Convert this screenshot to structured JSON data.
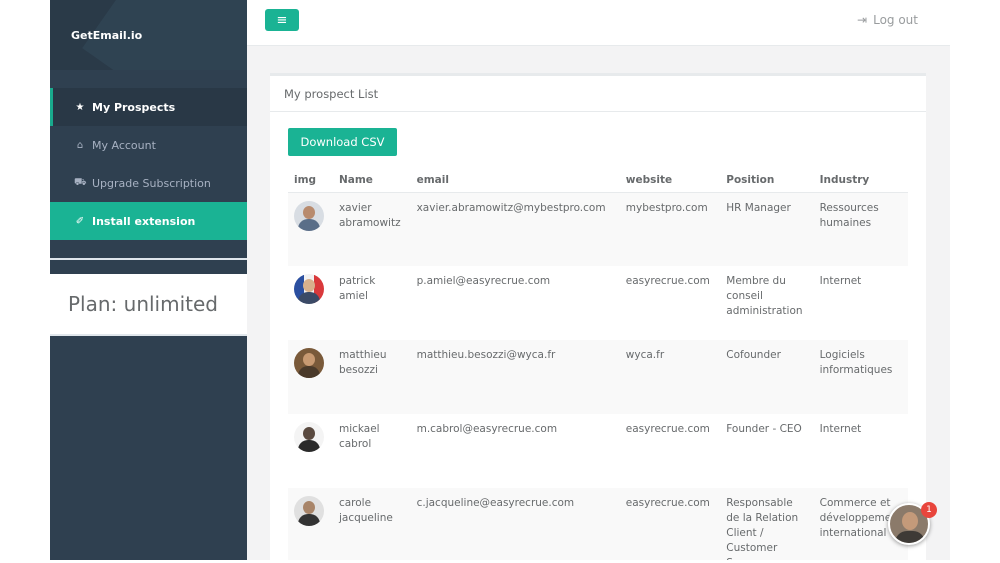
{
  "sidebar": {
    "brand": "GetEmail.io",
    "items": [
      {
        "label": "My Prospects",
        "icon": "star-icon",
        "glyph": "★"
      },
      {
        "label": "My Account",
        "icon": "home-icon",
        "glyph": "⌂"
      },
      {
        "label": "Upgrade Subscription",
        "icon": "cart-icon",
        "glyph": "⛟"
      },
      {
        "label": "Install extension",
        "icon": "magic-wand-icon",
        "glyph": "✐"
      }
    ],
    "plan": "Plan: unlimited"
  },
  "topbar": {
    "menu_glyph": "≡",
    "logout_glyph": "⇥",
    "logout_label": "Log out"
  },
  "panel": {
    "title": "My prospect List",
    "download_label": "Download CSV",
    "columns": [
      "img",
      "Name",
      "email",
      "website",
      "Position",
      "Industry"
    ],
    "rows": [
      {
        "name": "xavier abramowitz",
        "email": "xavier.abramowitz@mybestpro.com",
        "website": "mybestpro.com",
        "position": "HR Manager",
        "industry": "Ressources humaines"
      },
      {
        "name": "patrick amiel",
        "email": "p.amiel@easyrecrue.com",
        "website": "easyrecrue.com",
        "position": "Membre du conseil administration",
        "industry": "Internet"
      },
      {
        "name": "matthieu besozzi",
        "email": "matthieu.besozzi@wyca.fr",
        "website": "wyca.fr",
        "position": "Cofounder",
        "industry": "Logiciels informatiques"
      },
      {
        "name": "mickael cabrol",
        "email": "m.cabrol@easyrecrue.com",
        "website": "easyrecrue.com",
        "position": "Founder - CEO",
        "industry": "Internet"
      },
      {
        "name": "carole jacqueline",
        "email": "c.jacqueline@easyrecrue.com",
        "website": "easyrecrue.com",
        "position": "Responsable de la Relation Client / Customer Success",
        "industry": "Commerce et développement international"
      }
    ]
  },
  "chat": {
    "badge": "1"
  },
  "colors": {
    "accent": "#1ab394",
    "sidebar": "#2f4050",
    "badge": "#e8453c"
  }
}
